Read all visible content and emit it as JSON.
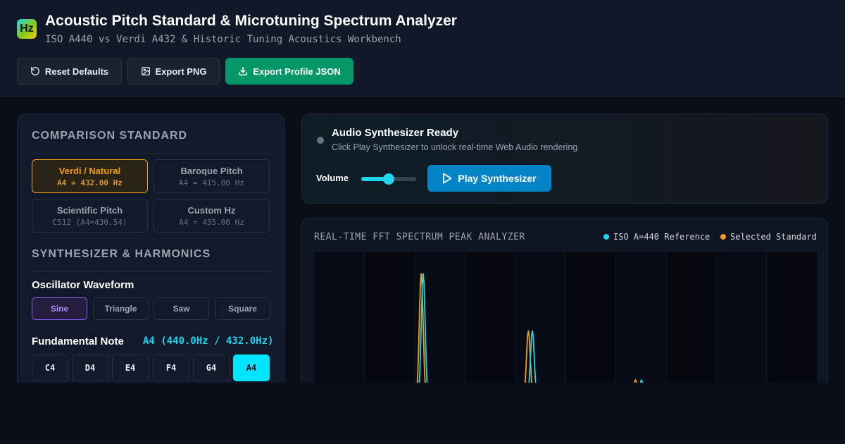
{
  "header": {
    "logo": "Hz",
    "title": "Acoustic Pitch Standard & Microtuning Spectrum Analyzer",
    "subtitle": "ISO A440 vs Verdi A432 & Historic Tuning Acoustics Workbench",
    "buttons": {
      "reset": "Reset Defaults",
      "export_png": "Export PNG",
      "export_json": "Export Profile JSON"
    }
  },
  "comparison": {
    "title": "COMPARISON STANDARD",
    "standards": [
      {
        "name": "Verdi / Natural",
        "value": "A4 = 432.00 Hz",
        "active": true
      },
      {
        "name": "Baroque Pitch",
        "value": "A4 = 415.00 Hz",
        "active": false
      },
      {
        "name": "Scientific Pitch",
        "value": "C512 (A4=430.54)",
        "active": false
      },
      {
        "name": "Custom Hz",
        "value": "A4 = 435.00 Hz",
        "active": false
      }
    ]
  },
  "synth": {
    "title": "SYNTHESIZER & HARMONICS",
    "waveform_label": "Oscillator Waveform",
    "waveforms": [
      "Sine",
      "Triangle",
      "Saw",
      "Square"
    ],
    "active_waveform": "Sine",
    "note_label": "Fundamental Note",
    "note_readout": "A4 (440.0Hz / 432.0Hz)",
    "notes": [
      "C4",
      "D4",
      "E4",
      "F4",
      "G4",
      "A4"
    ],
    "active_note": "A4"
  },
  "audio": {
    "status_title": "Audio Synthesizer Ready",
    "status_sub": "Click Play Synthesizer to unlock real-time Web Audio rendering",
    "volume_label": "Volume",
    "volume_level": 0.5,
    "play_label": "Play Synthesizer"
  },
  "spectrum": {
    "title": "REAL-TIME FFT SPECTRUM PEAK ANALYZER",
    "legend_reference": "ISO A=440 Reference",
    "legend_selected": "Selected Standard",
    "colors": {
      "reference": "#22d3ee",
      "selected": "#f59e0b"
    },
    "reference_peaks_hz": [
      440,
      880,
      1320
    ],
    "selected_peaks_hz": [
      432,
      864,
      1296
    ]
  }
}
